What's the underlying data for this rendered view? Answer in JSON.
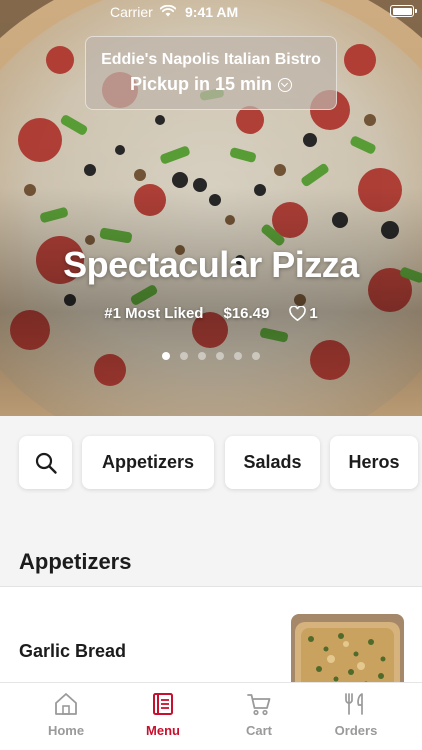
{
  "status_bar": {
    "carrier": "Carrier",
    "time": "9:41 AM"
  },
  "store": {
    "name": "Eddie's Napolis Italian Bistro",
    "pickup": "Pickup in 15 min"
  },
  "hero": {
    "title": "Spectacular Pizza",
    "rank": "#1 Most Liked",
    "price": "$16.49",
    "likes": "1",
    "slides": 6,
    "active_slide": 1
  },
  "categories": {
    "search_icon": "search-icon",
    "items": [
      "Appetizers",
      "Salads",
      "Heros"
    ]
  },
  "section": {
    "title": "Appetizers",
    "items": [
      {
        "name": "Garlic Bread"
      }
    ]
  },
  "tabbar": {
    "active": "Menu",
    "items": [
      {
        "label": "Home",
        "icon": "home-icon"
      },
      {
        "label": "Menu",
        "icon": "menu-icon"
      },
      {
        "label": "Cart",
        "icon": "cart-icon"
      },
      {
        "label": "Orders",
        "icon": "orders-icon"
      }
    ]
  },
  "colors": {
    "accent": "#c8102e",
    "inactive": "#9a9a9a",
    "background": "#f4f4f4"
  }
}
